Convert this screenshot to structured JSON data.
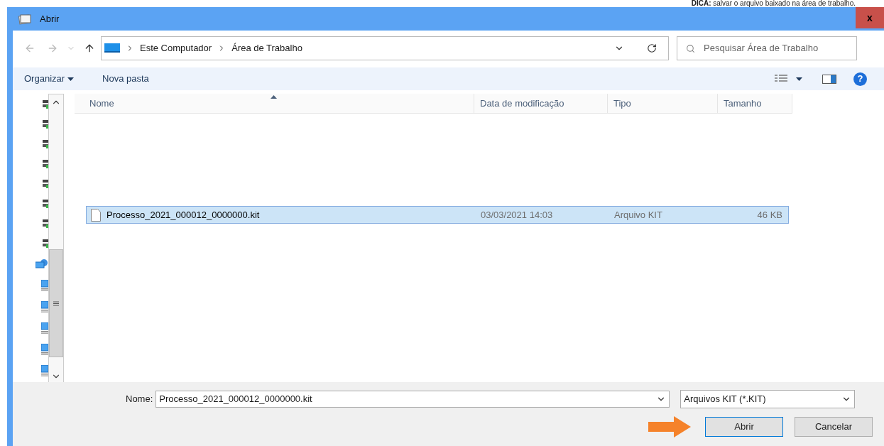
{
  "tip": "**DICA:** salvar o arquivo baixado na área de trabalho.",
  "window": {
    "title": "Abrir",
    "close": "x"
  },
  "address": {
    "crumbs": [
      "Este Computador",
      "Área de Trabalho"
    ]
  },
  "search": {
    "placeholder": "Pesquisar Área de Trabalho"
  },
  "toolbar": {
    "organize": "Organizar",
    "new_folder": "Nova pasta",
    "help": "?"
  },
  "table": {
    "columns": [
      "Nome",
      "Data de modificação",
      "Tipo",
      "Tamanho"
    ],
    "rows": [
      {
        "name": "Processo_2021_000012_0000000.kit",
        "date": "03/03/2021 14:03",
        "type": "Arquivo KIT",
        "size": "46 KB",
        "selected": true
      }
    ]
  },
  "filename": {
    "label": "Nome:",
    "value": "Processo_2021_000012_0000000.kit"
  },
  "filter": {
    "value": "Arquivos KIT (*.KIT)"
  },
  "buttons": [
    {
      "label": "Abrir",
      "kind": "primary"
    },
    {
      "label": "Cancelar",
      "kind": "secondary"
    }
  ]
}
